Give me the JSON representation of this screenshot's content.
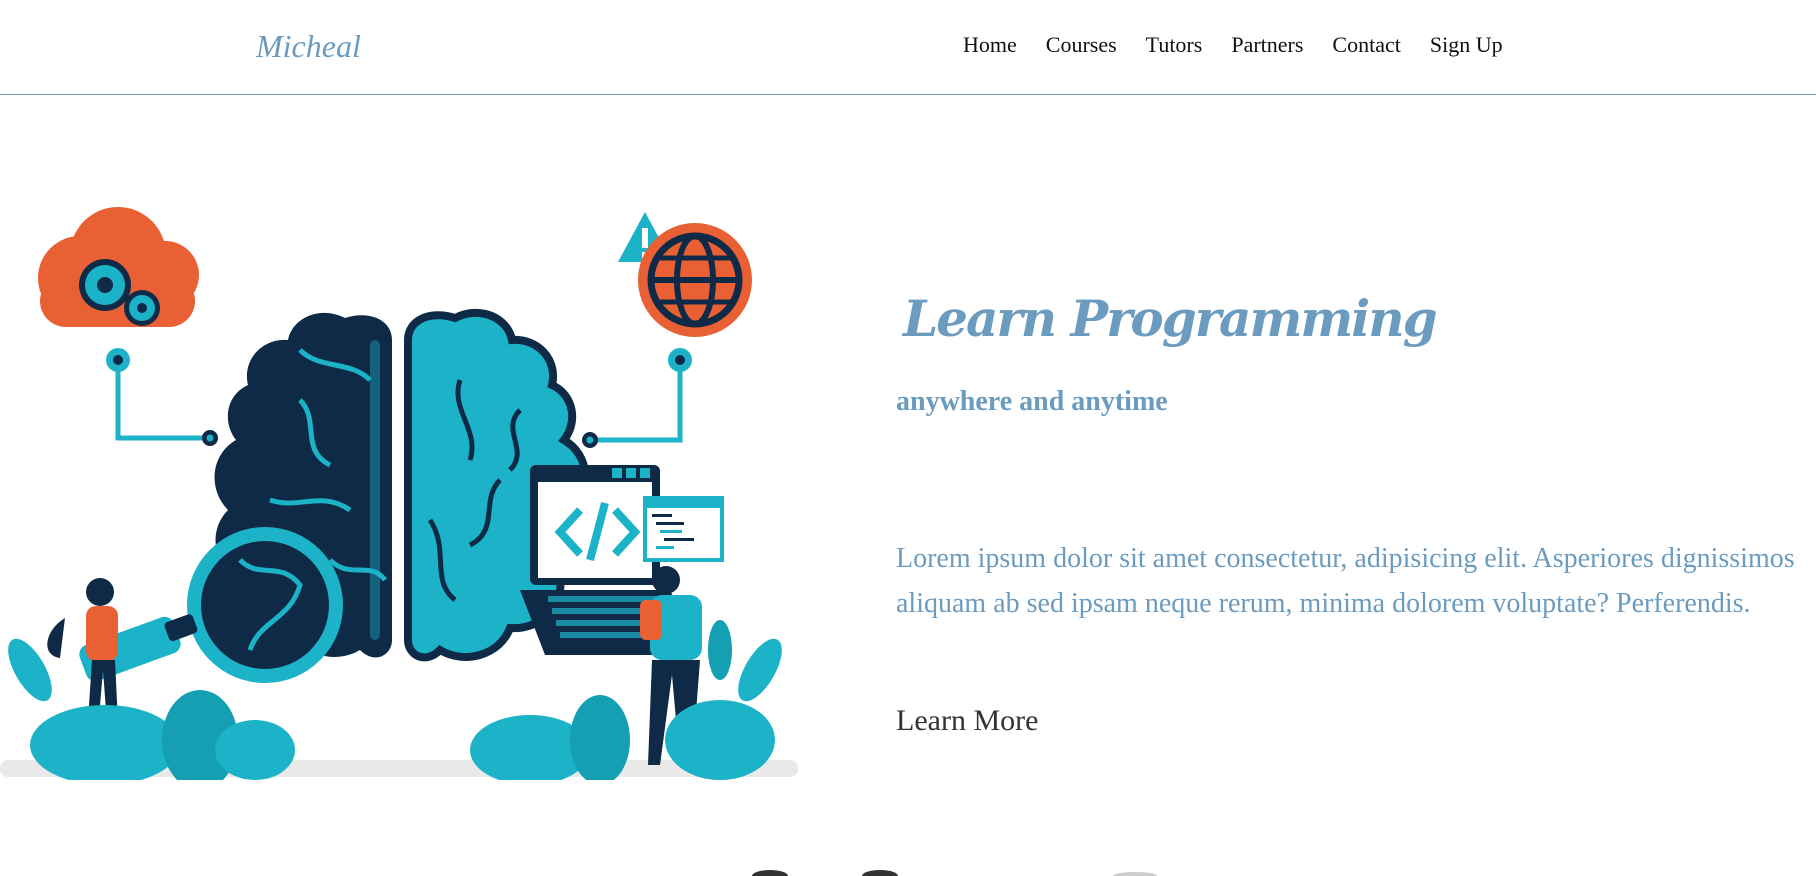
{
  "brand": {
    "name": "Micheal"
  },
  "nav": {
    "items": [
      {
        "label": "Home"
      },
      {
        "label": "Courses"
      },
      {
        "label": "Tutors"
      },
      {
        "label": "Partners"
      },
      {
        "label": "Contact"
      },
      {
        "label": "Sign Up"
      }
    ]
  },
  "hero": {
    "title": "Learn Programming",
    "subtitle": "anywhere and anytime",
    "body": "Lorem ipsum dolor sit amet consectetur, adipisicing elit. Asperiores dignissimos aliquam ab sed ipsam neque rerum, minima dolorem voluptate? Perferendis.",
    "cta": "Learn More",
    "illustration": {
      "icons": [
        "cloud-gear-icon",
        "warning-icon",
        "globe-icon",
        "code-icon",
        "magnifier-icon",
        "laptop-icon"
      ]
    }
  },
  "colors": {
    "accent": "#6b9bbf",
    "teal": "#1cb3c8",
    "navy": "#0e2a47",
    "orange": "#ea6035",
    "border": "#6a9bb5"
  }
}
